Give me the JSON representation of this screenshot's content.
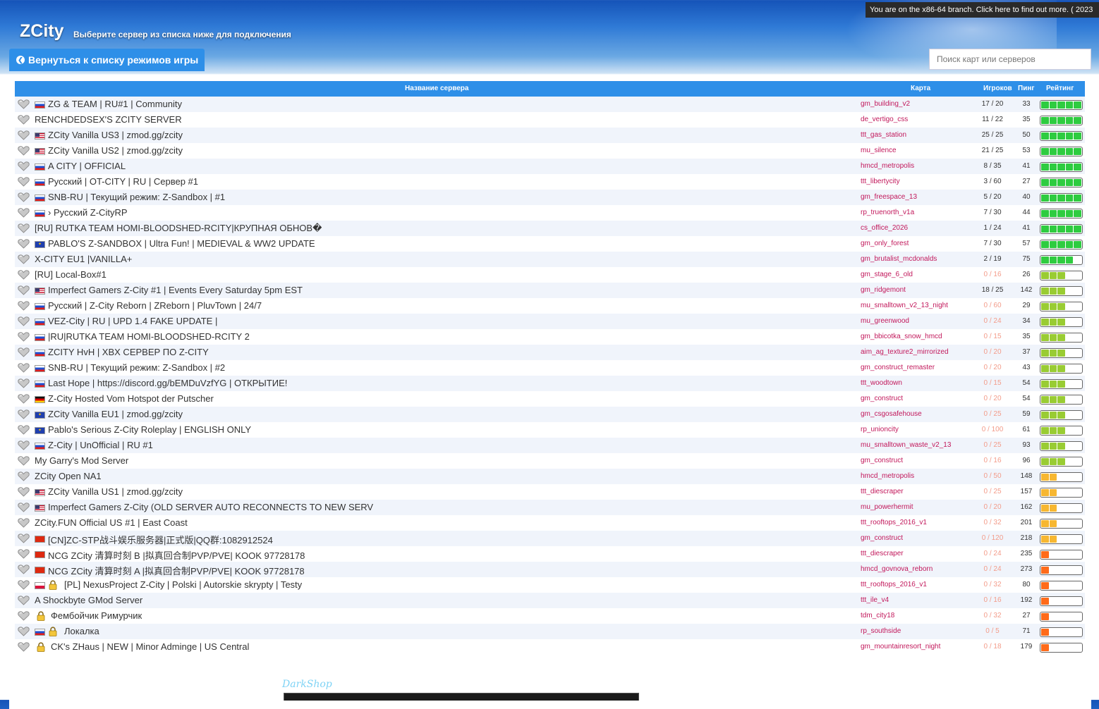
{
  "notice": "You are on the x86-64 branch. Click here to find out more. ( 2023",
  "header": {
    "logo": "ZCity",
    "subtitle": "Выберите сервер из списка ниже для подключения",
    "back_button": "Вернуться к списку режимов игры",
    "search_placeholder": "Поиск карт или серверов"
  },
  "columns": {
    "name": "Название сервера",
    "map": "Карта",
    "players": "Игроков",
    "ping": "Пинг",
    "rating": "Рейтинг"
  },
  "colors": {
    "accent": "#2e8fe8",
    "rating_green": "#2ecc40",
    "rating_lime": "#99cc33",
    "rating_orange": "#f7b731",
    "rating_red": "#ff6b1a",
    "map_text": "#c2185b"
  },
  "servers": [
    {
      "flag": "ru",
      "lock": false,
      "name": "ZG & TEAM | RU#1 | Community",
      "map": "gm_building_v2",
      "players": "17 / 20",
      "ping": "33",
      "rating": 5
    },
    {
      "flag": "",
      "lock": false,
      "name": "RENCHDEDSEX'S ZCITY SERVER",
      "map": "de_vertigo_css",
      "players": "11 / 22",
      "ping": "35",
      "rating": 5
    },
    {
      "flag": "us",
      "lock": false,
      "name": "ZCity Vanilla US3 | zmod.gg/zcity",
      "map": "ttt_gas_station",
      "players": "25 / 25",
      "ping": "50",
      "rating": 5
    },
    {
      "flag": "us",
      "lock": false,
      "name": "ZCity Vanilla US2 | zmod.gg/zcity",
      "map": "mu_silence",
      "players": "21 / 25",
      "ping": "53",
      "rating": 5
    },
    {
      "flag": "ru",
      "lock": false,
      "name": "A CITY | OFFICIAL",
      "map": "hmcd_metropolis",
      "players": "8 / 35",
      "ping": "41",
      "rating": 5
    },
    {
      "flag": "ru",
      "lock": false,
      "name": "Русский | OT-CITY | RU | Сервер #1",
      "map": "ttt_libertycity",
      "players": "3 / 60",
      "ping": "27",
      "rating": 5
    },
    {
      "flag": "ru",
      "lock": false,
      "name": "SNB-RU | Текущий режим: Z-Sandbox | #1",
      "map": "gm_freespace_13",
      "players": "5 / 20",
      "ping": "40",
      "rating": 5
    },
    {
      "flag": "ru",
      "lock": false,
      "name": "› Русский Z-CityRP",
      "map": "rp_truenorth_v1a",
      "players": "7 / 30",
      "ping": "44",
      "rating": 5
    },
    {
      "flag": "",
      "lock": false,
      "name": "[RU] RUTKA TEAM HOMI-BLOODSHED-RCITY|КРУПНАЯ ОБНОВ�",
      "map": "cs_office_2026",
      "players": "1 / 24",
      "ping": "41",
      "rating": 5
    },
    {
      "flag": "eu",
      "lock": false,
      "name": "PABLO'S Z-SANDBOX | Ultra Fun! | MEDIEVAL & WW2 UPDATE",
      "map": "gm_only_forest",
      "players": "7 / 30",
      "ping": "57",
      "rating": 5
    },
    {
      "flag": "",
      "lock": false,
      "name": "X-CITY EU1 |VANILLA+",
      "map": "gm_brutalist_mcdonalds",
      "players": "2 / 19",
      "ping": "75",
      "rating": 4
    },
    {
      "flag": "",
      "lock": false,
      "name": "[RU] Local-Box#1",
      "map": "gm_stage_6_old",
      "players": "0 / 16",
      "ping": "26",
      "rating": 3
    },
    {
      "flag": "us",
      "lock": false,
      "name": "Imperfect Gamers Z-City #1 | Events Every Saturday 5pm EST",
      "map": "gm_ridgemont",
      "players": "18 / 25",
      "ping": "142",
      "rating": 3
    },
    {
      "flag": "ru",
      "lock": false,
      "name": "Русский | Z-City Reborn | ZReborn | PluvTown | 24/7",
      "map": "mu_smalltown_v2_13_night",
      "players": "0 / 60",
      "ping": "29",
      "rating": 3
    },
    {
      "flag": "ru",
      "lock": false,
      "name": "VEZ-City | RU | UPD 1.4 FAKE UPDATE |",
      "map": "mu_greenwood",
      "players": "0 / 24",
      "ping": "34",
      "rating": 3
    },
    {
      "flag": "ru",
      "lock": false,
      "name": "|RU|RUTKA TEAM HOMI-BLOODSHED-RCITY 2",
      "map": "gm_bbicotka_snow_hmcd",
      "players": "0 / 15",
      "ping": "35",
      "rating": 3
    },
    {
      "flag": "ru",
      "lock": false,
      "name": "ZCITY HvH | XBX СЕРВЕР ПО Z-CITY",
      "map": "aim_ag_texture2_mirrorized",
      "players": "0 / 20",
      "ping": "37",
      "rating": 3
    },
    {
      "flag": "ru",
      "lock": false,
      "name": "SNB-RU | Текущий режим: Z-Sandbox | #2",
      "map": "gm_construct_remaster",
      "players": "0 / 20",
      "ping": "43",
      "rating": 3
    },
    {
      "flag": "ru",
      "lock": false,
      "name": "Last Hope | https://discord.gg/bEMDuVzfYG | ОТКРЫТИЕ!",
      "map": "ttt_woodtown",
      "players": "0 / 15",
      "ping": "54",
      "rating": 3
    },
    {
      "flag": "de",
      "lock": false,
      "name": "Z-City Hosted Vom Hotspot der Putscher",
      "map": "gm_construct",
      "players": "0 / 20",
      "ping": "54",
      "rating": 3
    },
    {
      "flag": "eu",
      "lock": false,
      "name": "ZCity Vanilla EU1 | zmod.gg/zcity",
      "map": "gm_csgosafehouse",
      "players": "0 / 25",
      "ping": "59",
      "rating": 3
    },
    {
      "flag": "eu",
      "lock": false,
      "name": "Pablo's Serious Z-City Roleplay | ENGLISH ONLY",
      "map": "rp_unioncity",
      "players": "0 / 100",
      "ping": "61",
      "rating": 3
    },
    {
      "flag": "ru",
      "lock": false,
      "name": "Z-City | UnOfficial | RU #1",
      "map": "mu_smalltown_waste_v2_13",
      "players": "0 / 25",
      "ping": "93",
      "rating": 3
    },
    {
      "flag": "",
      "lock": false,
      "name": "My Garry's Mod Server",
      "map": "gm_construct",
      "players": "0 / 16",
      "ping": "96",
      "rating": 3
    },
    {
      "flag": "",
      "lock": false,
      "name": "ZCity Open NA1",
      "map": "hmcd_metropolis",
      "players": "0 / 50",
      "ping": "148",
      "rating": 2
    },
    {
      "flag": "us",
      "lock": false,
      "name": "ZCity Vanilla US1 | zmod.gg/zcity",
      "map": "ttt_diescraper",
      "players": "0 / 25",
      "ping": "157",
      "rating": 2
    },
    {
      "flag": "us",
      "lock": false,
      "name": "Imperfect Gamers Z-City (OLD SERVER AUTO RECONNECTS TO NEW SERV",
      "map": "mu_powerhermit",
      "players": "0 / 20",
      "ping": "162",
      "rating": 2
    },
    {
      "flag": "",
      "lock": false,
      "name": "ZCity.FUN Official US #1 | East Coast",
      "map": "ttt_rooftops_2016_v1",
      "players": "0 / 32",
      "ping": "201",
      "rating": 2
    },
    {
      "flag": "cn",
      "lock": false,
      "name": "[CN]ZC-STP战斗娱乐服务器|正式版|QQ群:1082912524",
      "map": "gm_construct",
      "players": "0 / 120",
      "ping": "218",
      "rating": 2
    },
    {
      "flag": "cn",
      "lock": false,
      "name": "NCG ZCity 清算时刻 B |拟真回合制PVP/PVE| KOOK 97728178",
      "map": "ttt_diescraper",
      "players": "0 / 24",
      "ping": "235",
      "rating": 1
    },
    {
      "flag": "cn",
      "lock": false,
      "name": "NCG ZCity 清算时刻 A |拟真回合制PVP/PVE| KOOK 97728178",
      "map": "hmcd_govnova_reborn",
      "players": "0 / 24",
      "ping": "273",
      "rating": 1
    },
    {
      "flag": "pl",
      "lock": true,
      "name": "[PL] NexusProject Z-City | Polski | Autorskie skrypty | Testy",
      "map": "ttt_rooftops_2016_v1",
      "players": "0 / 32",
      "ping": "80",
      "rating": 1
    },
    {
      "flag": "",
      "lock": false,
      "name": "A Shockbyte GMod Server",
      "map": "ttt_ile_v4",
      "players": "0 / 16",
      "ping": "192",
      "rating": 1
    },
    {
      "flag": "",
      "lock": true,
      "name": "Фембойчик Римурчик",
      "map": "tdm_city18",
      "players": "0 / 32",
      "ping": "27",
      "rating": 1
    },
    {
      "flag": "ru",
      "lock": true,
      "name": "Локалка",
      "map": "rp_southside",
      "players": "0 / 5",
      "ping": "71",
      "rating": 1
    },
    {
      "flag": "",
      "lock": true,
      "name": "CK's ZHaus | NEW | Minor Adminge | US Central",
      "map": "gm_mountainresort_night",
      "players": "0 / 18",
      "ping": "179",
      "rating": 1
    }
  ],
  "watermark": "DarkShop"
}
